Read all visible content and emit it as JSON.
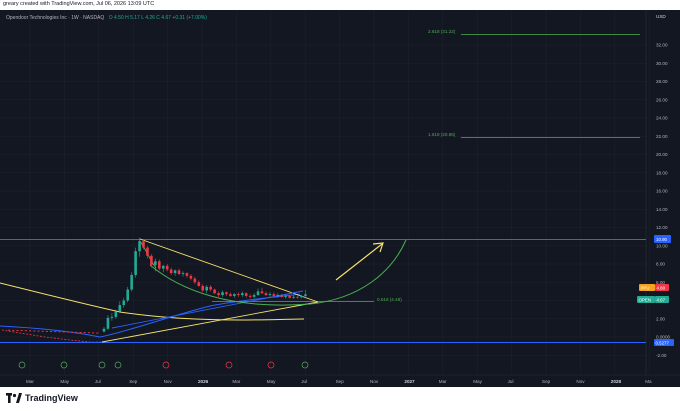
{
  "header": {
    "caption": "greary created with TradingView.com, Jul 06, 2026 13:09 UTC"
  },
  "legend": {
    "symbol": "Opendoor Technologies Inc · 1W · NASDAQ",
    "ohlc": "O 4.50  H 5.17  L 4.26  C 4.67  +0.31 (+7.00%)"
  },
  "price_axis": {
    "currency": "USD",
    "ticks": [
      "32.00",
      "30.00",
      "28.00",
      "26.00",
      "24.00",
      "22.00",
      "20.00",
      "18.00",
      "16.00",
      "14.00",
      "12.00",
      "10.00",
      "8.00",
      "6.00",
      "4.00",
      "2.00",
      "0.0000",
      "-2.00"
    ]
  },
  "time_axis": {
    "ticks": [
      "Mar",
      "May",
      "Jul",
      "Sep",
      "Nov",
      "2026",
      "Mar",
      "May",
      "Jul",
      "Sep",
      "Nov",
      "2027",
      "Mar",
      "May",
      "Jul",
      "Sep",
      "Nov",
      "2028",
      "Ma"
    ]
  },
  "annotations": {
    "fib_2618": "2.618 (31.22)",
    "fib_1618": "1.618 (20.86)",
    "fib_0618": "0.618 (4.48)"
  },
  "price_tags": {
    "upper": "10.90",
    "ppu": "PPU",
    "ppu_value": "4.80",
    "open": "OPEN",
    "open_value": "4.67",
    "lower": "0.5277"
  },
  "branding": {
    "name": "TradingView"
  },
  "colors": {
    "background": "#131722",
    "up": "#22ab94",
    "down": "#f23645",
    "blue_line": "#2962ff",
    "yellow_line": "#f7e26b",
    "fib_green": "#4caf50",
    "arrow": "#f7e26b"
  },
  "chart_data": {
    "type": "candlestick",
    "symbol": "OPEN",
    "timeframe": "1W",
    "ylim": [
      -2,
      33
    ],
    "x": [
      "2025-07-07",
      "2025-07-14",
      "2025-07-21",
      "2025-07-28",
      "2025-08-04",
      "2025-08-11",
      "2025-08-18",
      "2025-08-25",
      "2025-09-01",
      "2025-09-08",
      "2025-09-15",
      "2025-09-22",
      "2025-09-29",
      "2025-10-06",
      "2025-10-13",
      "2025-10-20",
      "2025-10-27",
      "2025-11-03",
      "2025-11-10",
      "2025-11-17",
      "2025-11-24",
      "2025-12-01",
      "2025-12-08",
      "2025-12-15",
      "2025-12-22",
      "2025-12-29",
      "2026-01-05",
      "2026-01-12",
      "2026-01-19",
      "2026-01-26",
      "2026-02-02",
      "2026-02-09",
      "2026-02-16",
      "2026-02-23",
      "2026-03-02",
      "2026-03-09",
      "2026-03-16",
      "2026-03-23",
      "2026-03-30",
      "2026-04-06",
      "2026-04-13",
      "2026-04-20",
      "2026-04-27",
      "2026-05-04",
      "2026-05-11",
      "2026-05-18",
      "2026-05-25",
      "2026-06-01",
      "2026-06-08",
      "2026-06-15",
      "2026-06-22",
      "2026-06-29"
    ],
    "open": [
      0.6,
      0.9,
      2.1,
      2.2,
      2.8,
      3.5,
      4.0,
      5.2,
      6.8,
      9.4,
      10.5,
      9.8,
      8.9,
      7.9,
      8.3,
      7.5,
      7.8,
      7.4,
      7.0,
      7.3,
      6.9,
      7.0,
      6.7,
      6.4,
      6.0,
      5.6,
      5.1,
      5.5,
      5.2,
      4.8,
      4.6,
      4.9,
      4.7,
      4.5,
      4.7,
      4.6,
      4.8,
      4.5,
      4.4,
      4.6,
      5.0,
      4.8,
      4.6,
      4.7,
      4.5,
      4.6,
      4.4,
      4.5,
      4.3,
      4.4,
      4.36,
      4.5
    ],
    "high": [
      1.1,
      2.4,
      2.6,
      3.0,
      3.9,
      4.3,
      5.5,
      7.1,
      9.8,
      10.9,
      10.7,
      10.0,
      9.1,
      8.6,
      8.5,
      7.9,
      8.0,
      7.6,
      7.4,
      7.5,
      7.2,
      7.1,
      6.9,
      6.6,
      6.2,
      5.8,
      5.7,
      5.7,
      5.3,
      5.0,
      5.1,
      5.0,
      4.9,
      4.8,
      4.9,
      5.0,
      4.9,
      4.7,
      4.8,
      5.3,
      5.4,
      5.0,
      4.9,
      4.9,
      4.8,
      4.7,
      4.7,
      4.6,
      4.6,
      4.6,
      4.6,
      5.17
    ],
    "low": [
      0.5,
      0.8,
      1.8,
      2.0,
      2.6,
      3.2,
      3.8,
      5.0,
      6.5,
      8.8,
      9.6,
      8.6,
      7.6,
      7.2,
      7.3,
      7.1,
      7.2,
      6.8,
      6.7,
      6.8,
      6.6,
      6.5,
      6.2,
      5.8,
      5.5,
      4.9,
      4.8,
      5.0,
      4.7,
      4.4,
      4.4,
      4.5,
      4.4,
      4.3,
      4.4,
      4.4,
      4.3,
      4.2,
      4.2,
      4.5,
      4.7,
      4.5,
      4.4,
      4.4,
      4.3,
      4.3,
      4.2,
      4.2,
      4.2,
      4.2,
      4.2,
      4.26
    ],
    "close": [
      0.9,
      2.1,
      2.2,
      2.8,
      3.5,
      4.0,
      5.2,
      6.8,
      9.4,
      10.5,
      9.8,
      8.9,
      7.9,
      8.3,
      7.5,
      7.8,
      7.4,
      7.0,
      7.3,
      6.9,
      7.0,
      6.7,
      6.4,
      6.0,
      5.6,
      5.1,
      5.5,
      5.2,
      4.8,
      4.6,
      4.9,
      4.7,
      4.5,
      4.7,
      4.6,
      4.8,
      4.5,
      4.4,
      4.6,
      5.0,
      4.8,
      4.6,
      4.7,
      4.5,
      4.6,
      4.4,
      4.5,
      4.3,
      4.4,
      4.36,
      4.5,
      4.67
    ],
    "levels": {
      "resistance": 10.9,
      "support": 0.5277,
      "fib_0618": 4.48,
      "fib_1618": 20.86,
      "fib_2618": 31.22
    }
  }
}
